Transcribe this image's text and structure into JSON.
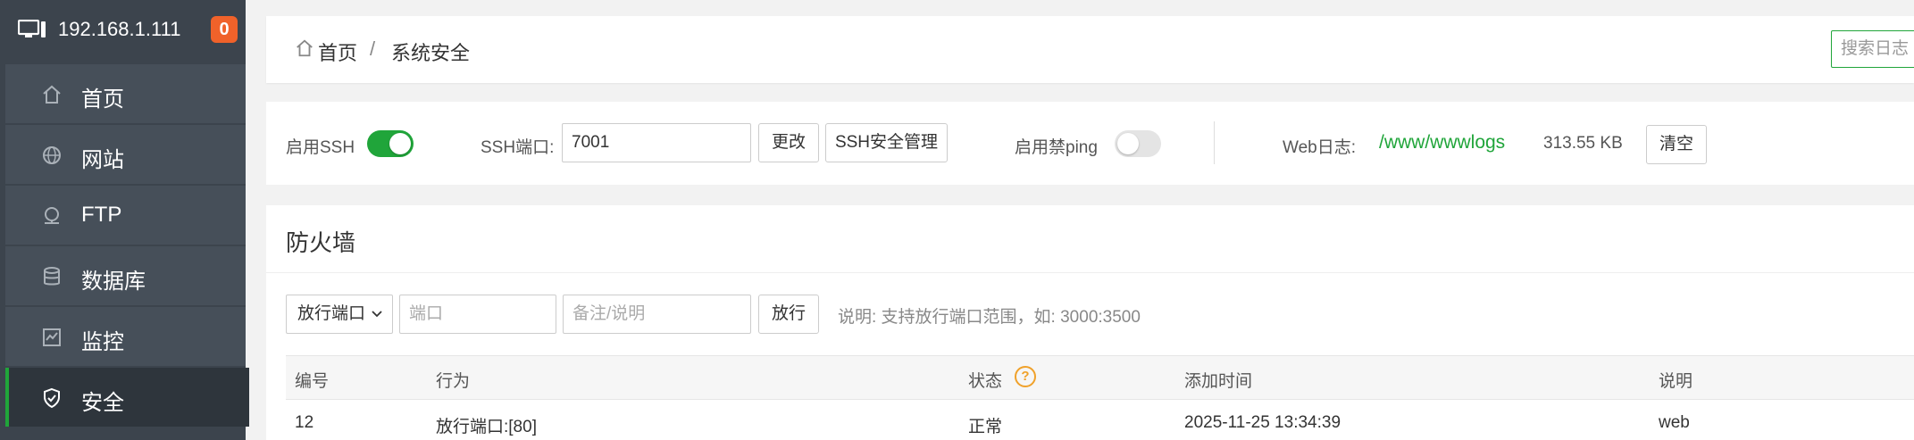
{
  "server": {
    "ip": "192.168.1.111",
    "notification_count": "0"
  },
  "sidebar": {
    "items": [
      {
        "label": "首页",
        "icon": "home-icon"
      },
      {
        "label": "网站",
        "icon": "globe-icon"
      },
      {
        "label": "FTP",
        "icon": "ftp-icon"
      },
      {
        "label": "数据库",
        "icon": "database-icon"
      },
      {
        "label": "监控",
        "icon": "monitor-icon"
      },
      {
        "label": "安全",
        "icon": "shield-icon",
        "active": true
      }
    ]
  },
  "breadcrumb": {
    "home": "首页",
    "separator": "/",
    "current": "系统安全"
  },
  "header": {
    "search_placeholder": "搜索日志"
  },
  "settings": {
    "ssh_label": "启用SSH",
    "ssh_enabled": true,
    "ssh_port_label": "SSH端口:",
    "ssh_port_value": "7001",
    "change_button": "更改",
    "ssh_manage_button": "SSH安全管理",
    "ping_label": "启用禁ping",
    "ping_blocked": false,
    "weblog_label": "Web日志:",
    "weblog_path": "/www/wwwlogs",
    "weblog_size": "313.55 KB",
    "clear_button": "清空"
  },
  "firewall": {
    "title": "防火墙",
    "action_select": "放行端口",
    "port_placeholder": "端口",
    "note_placeholder": "备注/说明",
    "allow_button": "放行",
    "hint": "说明: 支持放行端口范围，如: 3000:3500",
    "columns": [
      "编号",
      "行为",
      "状态",
      "添加时间",
      "说明"
    ],
    "rows": [
      {
        "id": "12",
        "action": "放行端口:[80]",
        "status": "正常",
        "time": "2025-11-25 13:34:39",
        "note": "web"
      }
    ]
  },
  "colors": {
    "accent": "#20a53a",
    "sidebar_bg": "#3c444d",
    "badge": "#f0622a"
  }
}
